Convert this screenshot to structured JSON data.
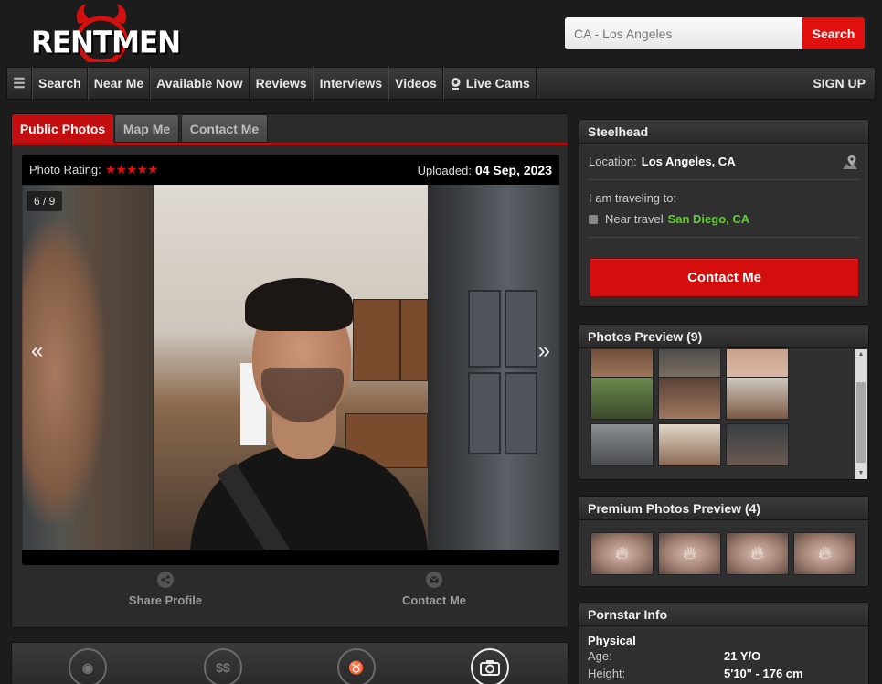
{
  "header": {
    "logo_text": "RENTMEN",
    "search_placeholder": "CA - Los Angeles",
    "search_button": "Search"
  },
  "nav": {
    "menu_icon": "hamburger-icon",
    "items": [
      "Search",
      "Near Me",
      "Available Now",
      "Reviews",
      "Interviews",
      "Videos",
      "Live Cams"
    ],
    "signup": "SIGN UP"
  },
  "tabs": {
    "public_photos": "Public Photos",
    "map_me": "Map Me",
    "contact_me": "Contact Me"
  },
  "viewer": {
    "rating_label": "Photo Rating:",
    "stars": "★★★★★",
    "uploaded_label": "Uploaded:",
    "uploaded_date": "04 Sep, 2023",
    "counter": "6 / 9",
    "prev": "«",
    "next": "»"
  },
  "actions": {
    "share": "Share Profile",
    "contact": "Contact Me"
  },
  "profile": {
    "name": "Steelhead",
    "location_label": "Location:",
    "location": "Los Angeles, CA",
    "travel_title": "I am traveling to:",
    "travel_label": "Near travel",
    "travel_city": "San Diego, CA",
    "contact_button": "Contact Me"
  },
  "photos_preview": {
    "title": "Photos Preview (9)"
  },
  "premium_preview": {
    "title": "Premium Photos Preview (4)"
  },
  "pornstar_info": {
    "title": "Pornstar Info",
    "section": "Physical",
    "rows": [
      {
        "label": "Age:",
        "value": "21 Y/O"
      },
      {
        "label": "Height:",
        "value": "5'10\" - 176 cm"
      }
    ]
  },
  "colors": {
    "accent_red": "#e0100f",
    "travel_green": "#5fd12a"
  }
}
